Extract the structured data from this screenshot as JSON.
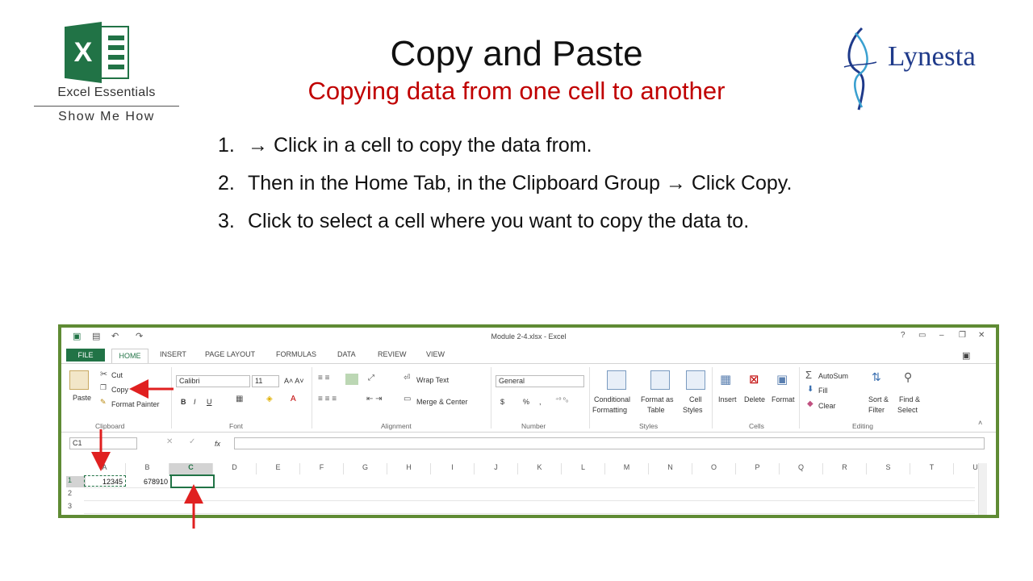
{
  "logo": {
    "letter": "X",
    "title": "Excel Essentials",
    "subtitle": "Show Me How"
  },
  "brand": {
    "name": "Lynesta"
  },
  "title": "Copy and Paste",
  "subtitle": "Copying data from one cell to another",
  "steps": [
    {
      "num": "1.",
      "text": "→ Click in a cell to copy the data from."
    },
    {
      "num": "2.",
      "text": "Then in the Home Tab, in the Clipboard Group → Click Copy."
    },
    {
      "num": "3.",
      "text": "Click to select a cell where you want to copy the data to."
    }
  ],
  "excel": {
    "window_title": "Module 2-4.xlsx - Excel",
    "tabs": [
      "FILE",
      "HOME",
      "INSERT",
      "PAGE LAYOUT",
      "FORMULAS",
      "DATA",
      "REVIEW",
      "VIEW"
    ],
    "clipboard": {
      "paste": "Paste",
      "cut": "Cut",
      "copy": "Copy",
      "format_painter": "Format Painter",
      "label": "Clipboard"
    },
    "font": {
      "name": "Calibri",
      "size": "11",
      "label": "Font",
      "bold": "B",
      "italic": "I",
      "underline": "U"
    },
    "alignment": {
      "wrap": "Wrap Text",
      "merge": "Merge & Center",
      "label": "Alignment"
    },
    "number": {
      "format": "General",
      "label": "Number",
      "currency": "$",
      "percent": "%",
      "comma": ","
    },
    "styles": {
      "conditional": "Conditional",
      "conditional2": "Formatting",
      "format_as": "Format as",
      "format_as2": "Table",
      "cell": "Cell",
      "cell2": "Styles",
      "label": "Styles"
    },
    "cells": {
      "insert": "Insert",
      "delete": "Delete",
      "format": "Format",
      "label": "Cells"
    },
    "editing": {
      "autosum": "AutoSum",
      "fill": "Fill",
      "clear": "Clear",
      "sort": "Sort &",
      "sort2": "Filter",
      "find": "Find &",
      "find2": "Select",
      "label": "Editing"
    },
    "name_box": "C1",
    "fx": "fx",
    "columns": [
      "A",
      "B",
      "C",
      "D",
      "E",
      "F",
      "G",
      "H",
      "I",
      "J",
      "K",
      "L",
      "M",
      "N",
      "O",
      "P",
      "Q",
      "R",
      "S",
      "T",
      "U"
    ],
    "rows": [
      "1",
      "2",
      "3"
    ],
    "cells_data": {
      "A1": "12345",
      "B1": "678910"
    },
    "help": "?"
  },
  "colors": {
    "excel_green": "#217346",
    "subtitle_red": "#c00000",
    "arrow_red": "#e02020",
    "frame_green": "#5f8b34"
  }
}
